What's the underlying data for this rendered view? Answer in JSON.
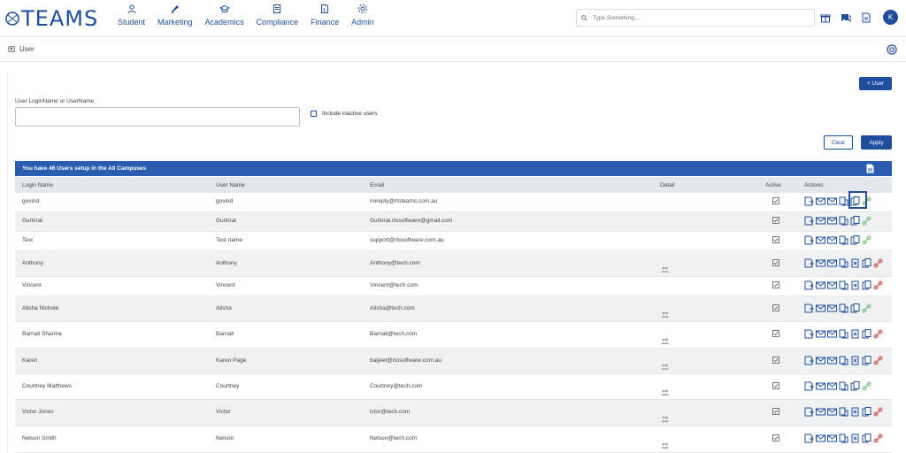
{
  "app": {
    "logo_text": "TEAMS"
  },
  "nav": [
    {
      "label": "Student",
      "icon": "student-icon"
    },
    {
      "label": "Marketing",
      "icon": "marketing-icon"
    },
    {
      "label": "Academics",
      "icon": "academics-icon"
    },
    {
      "label": "Compliance",
      "icon": "compliance-icon"
    },
    {
      "label": "Finance",
      "icon": "finance-icon"
    },
    {
      "label": "Admin",
      "icon": "admin-icon"
    }
  ],
  "search": {
    "placeholder": "Type Something..."
  },
  "user": {
    "initial": "K"
  },
  "breadcrumb": {
    "label": "User"
  },
  "buttons": {
    "add_user": "+ User",
    "clear": "Clear",
    "apply": "Apply"
  },
  "filter": {
    "label": "User LoginName or UserName",
    "value": "",
    "include_inactive": "Include inactive users"
  },
  "table": {
    "summary": "You have 46 Users setup in the All Campuses",
    "columns": {
      "login": "Login Name",
      "user": "User Name",
      "email": "Email",
      "detail": "Detail",
      "active": "Active",
      "actions": "Actions"
    },
    "rows": [
      {
        "login": "govind",
        "user": "govind",
        "email": "noreply@rtoteams.com.au",
        "detail": false,
        "active": true,
        "link_color": "#7cc47f"
      },
      {
        "login": "Gurkirat",
        "user": "Gurkirat",
        "email": "Gurkirat.rtosoftware@gmail.com",
        "detail": false,
        "active": true,
        "link_color": "#7cc47f"
      },
      {
        "login": "Test",
        "user": "Test name",
        "email": "support@rtosoftware.com.au",
        "detail": false,
        "active": true,
        "link_color": "#7cc47f"
      },
      {
        "login": "Anthony",
        "user": "Anthony",
        "email": "Anthony@tech.com",
        "detail": true,
        "active": true,
        "link_color": "#d9534f"
      },
      {
        "login": "Vincent",
        "user": "Vincent",
        "email": "Vincent@tech.com",
        "detail": false,
        "active": true,
        "link_color": "#d9534f"
      },
      {
        "login": "Alisha Nichole",
        "user": "Alisha",
        "email": "Alisha@tech.com",
        "detail": true,
        "active": true,
        "link_color": "#7cc47f"
      },
      {
        "login": "Barnali Sharma",
        "user": "Barnali",
        "email": "Barnali@tech.com",
        "detail": true,
        "active": true,
        "link_color": "#d9534f"
      },
      {
        "login": "Karen",
        "user": "Karen Page",
        "email": "baljeet@rtosoftware.com.au",
        "detail": true,
        "active": true,
        "link_color": "#d9534f"
      },
      {
        "login": "Courtney Matthews",
        "user": "Courtney",
        "email": "Courtney@tech.com",
        "detail": true,
        "active": true,
        "link_color": "#7cc47f"
      },
      {
        "login": "Victor Jones",
        "user": "Victor",
        "email": "ictor@tech.com",
        "detail": true,
        "active": true,
        "link_color": "#d9534f"
      },
      {
        "login": "Nelson Smith",
        "user": "Nelson",
        "email": "Nelson@tech.com",
        "detail": true,
        "active": true,
        "link_color": "#d9534f"
      }
    ]
  },
  "colors": {
    "brand": "#1f4e9c",
    "header_bar": "#2a5db0"
  }
}
